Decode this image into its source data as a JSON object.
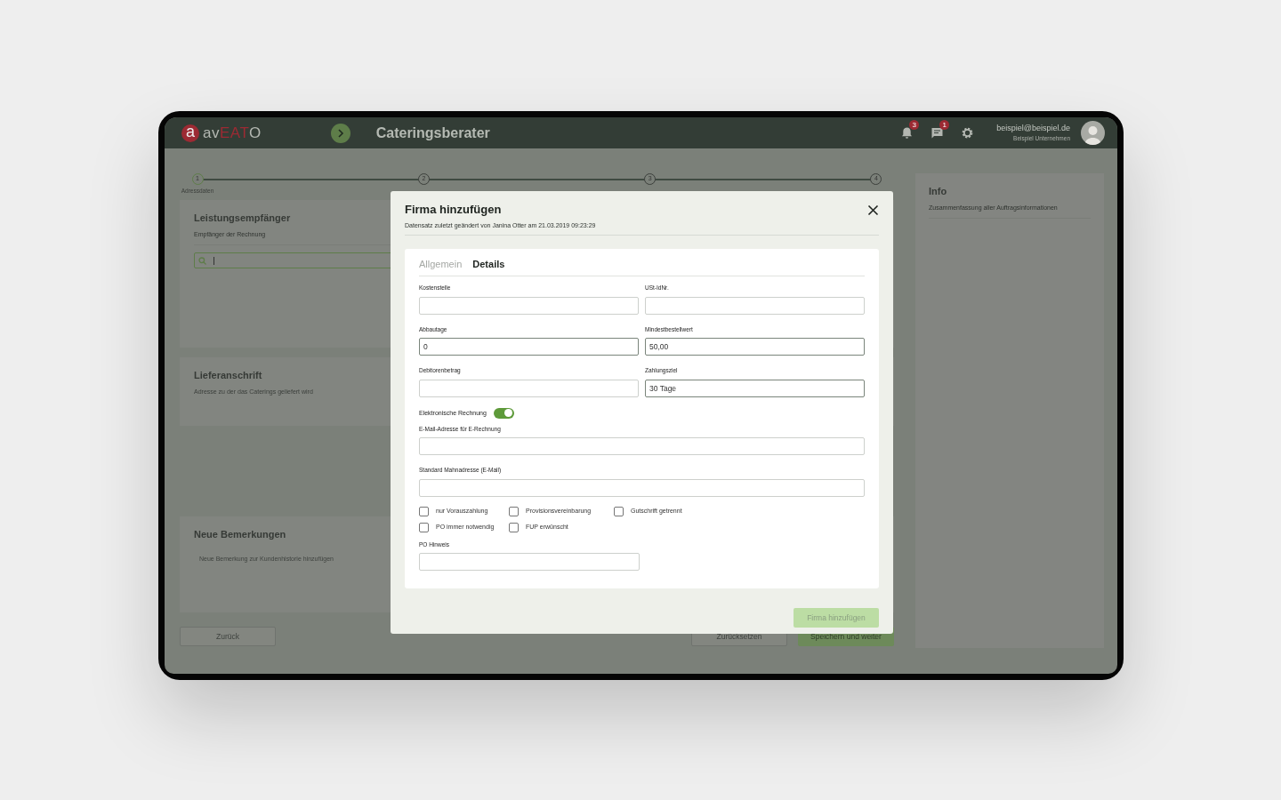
{
  "header": {
    "logo": {
      "mark": "a",
      "parts": [
        {
          "text": "av",
          "accent": false
        },
        {
          "text": "EAT",
          "accent": true
        },
        {
          "text": "O",
          "accent": false
        }
      ]
    },
    "title": "Cateringsberater",
    "notifications": "3",
    "messages": "1",
    "user": {
      "email": "beispiel@beispiel.de",
      "company": "Beispiel Unternehmen"
    }
  },
  "steps": [
    {
      "number": "1",
      "label": "Adressdaten",
      "selected": true
    },
    {
      "number": "2",
      "selected": false
    },
    {
      "number": "3",
      "selected": false
    },
    {
      "number": "4",
      "selected": false
    }
  ],
  "cards": [
    {
      "title": "Leistungsempfänger",
      "subtitle": "Empfänger der Rechnung",
      "kind": "search"
    },
    {
      "title": "Lieferanschrift",
      "subtitle": "Adresse zu der das Caterings geliefert wird",
      "kind": "plain"
    },
    {
      "title": "Neue Bemerkungen",
      "placeholder": "Neue Bemerkung zur Kundenhistorie hinzufügen",
      "kind": "note"
    }
  ],
  "buttons": {
    "back": "Zurück",
    "reset": "Zurücksetzen",
    "save": "Speichern und weiter"
  },
  "info": {
    "title": "Info",
    "subtitle": "Zusammenfassung aller Auftragsinformationen"
  },
  "dialog": {
    "title": "Firma hinzufügen",
    "subtitle": "Datensatz zuletzt geändert von Janina Otter am 21.03.2019 09:23:29",
    "tabs": [
      {
        "label": "Allgemein",
        "selected": false
      },
      {
        "label": "Details",
        "selected": true
      }
    ],
    "fields": [
      {
        "label": "Kostenstelle"
      },
      {
        "label": "USt-IdNr."
      },
      {
        "label": "Abbautage",
        "value": "0"
      },
      {
        "label": "Mindestbestellwert",
        "value": "50,00"
      },
      {
        "label": "Debitorenbetrag"
      },
      {
        "label": "Zahlungsziel",
        "value": "30 Tage"
      }
    ],
    "toggle": {
      "label": "Elektronische Rechnung",
      "on": true
    },
    "wide_fields": [
      {
        "label": "E-Mail-Adresse für E-Rechnung"
      },
      {
        "label": "Standard Mahnadresse (E-Mail)"
      }
    ],
    "checkboxes": [
      {
        "label": "nur Vorauszahlung",
        "checked": false
      },
      {
        "label": "Provisionsvereinbarung",
        "checked": false
      },
      {
        "label": "Gutschrift getrennt",
        "checked": false
      },
      {
        "label": "PO immer notwendig",
        "checked": false
      },
      {
        "label": "FUP erwünscht",
        "checked": false
      }
    ],
    "po_field": {
      "label": "PO Hinweis"
    },
    "submit": {
      "label": "Firma hinzufügen",
      "disabled": true
    }
  }
}
